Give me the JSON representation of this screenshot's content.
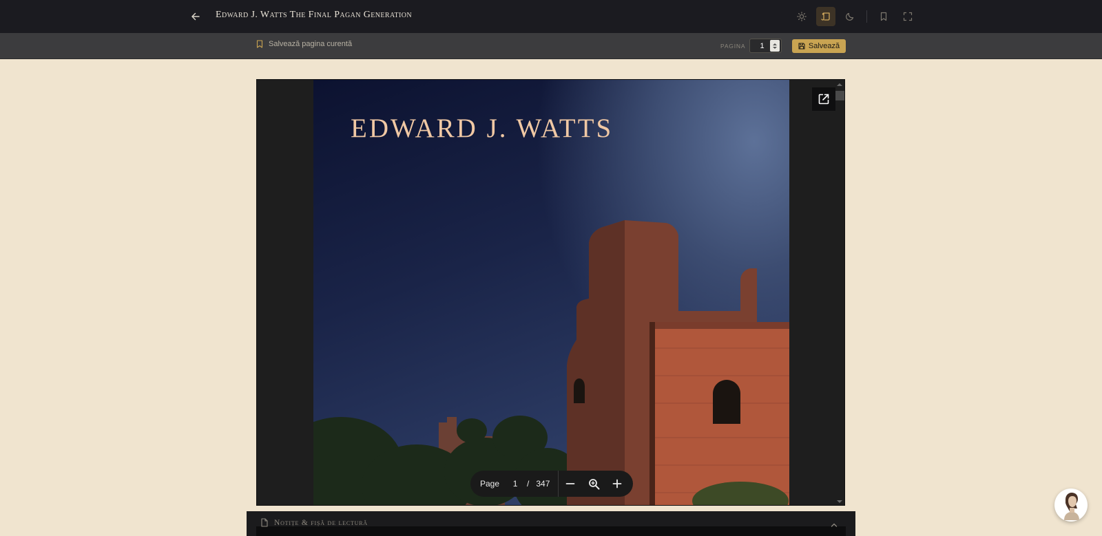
{
  "header": {
    "title": "Edward J. Watts The Final Pagan Generation",
    "icons": [
      "back-arrow-icon",
      "sun-icon",
      "scroll-icon",
      "moon-icon",
      "bookmark-icon",
      "fullscreen-icon"
    ],
    "active_mode": "scroll-icon"
  },
  "subbar": {
    "save_current_label": "Salvează pagina curentă",
    "page_label": "PAGINA",
    "page_value": "1",
    "save_button_label": "Salvează"
  },
  "viewer": {
    "cover_author": "EDWARD J. WATTS",
    "toolbar": {
      "page_label": "Page",
      "current_page": "1",
      "separator": "/",
      "total_pages": "347"
    }
  },
  "notes": {
    "title": "Notițe & fișă de lectură"
  },
  "colors": {
    "background": "#f0e4cf",
    "topbar": "#1b1b20",
    "subbar": "#3c3c3e",
    "accent": "#c9a452"
  }
}
